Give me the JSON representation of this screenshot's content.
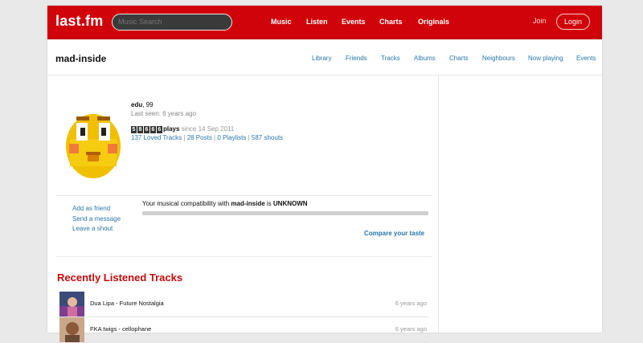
{
  "header": {
    "logo": "last.fm",
    "search_placeholder": "Music Search",
    "nav": [
      "Music",
      "Listen",
      "Events",
      "Charts",
      "Originals"
    ],
    "join": "Join",
    "login": "Login",
    "accent": "#d0020a"
  },
  "subheader": {
    "username": "mad-inside",
    "nav": [
      "Library",
      "Friends",
      "Tracks",
      "Albums",
      "Charts",
      "Neighbours",
      "Now playing",
      "Events"
    ]
  },
  "profile": {
    "name": "edu",
    "age": ", 99",
    "last_seen": "Last seen: 6 years ago",
    "play_digits": [
      "5",
      "8",
      "6",
      "6",
      "6"
    ],
    "plays_label": "plays",
    "since": " since 14 Sep 2011",
    "links": [
      "137 Loved Tracks",
      "28 Posts",
      "0 Playlists",
      "587 shouts"
    ],
    "link_sep": " | "
  },
  "actions": [
    "Add as friend",
    "Send a message",
    "Leave a shout"
  ],
  "compat": {
    "prefix": "Your musical compatibility with ",
    "user": "mad-inside",
    "mid": " is ",
    "level": "UNKNOWN",
    "fill_fraction": 0,
    "compare_label": "Compare your taste"
  },
  "recent": {
    "title": "Recently Listened Tracks",
    "tracks": [
      {
        "name": "Dua Lipa - Future Nostalgia",
        "time": "6 years ago"
      },
      {
        "name": "FKA twigs - cellophane",
        "time": "6 years ago"
      }
    ]
  }
}
